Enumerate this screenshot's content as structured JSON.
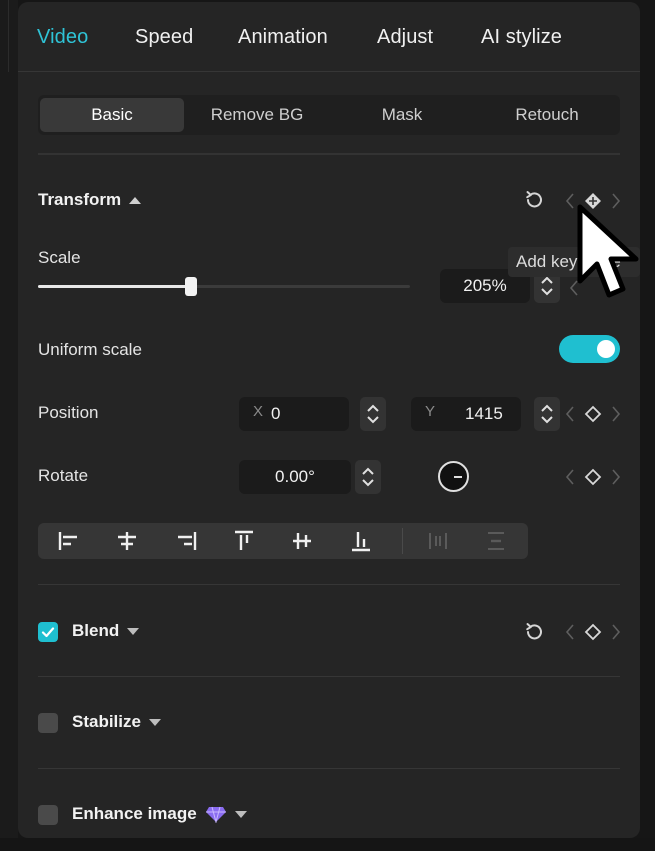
{
  "tabs": [
    "Video",
    "Speed",
    "Animation",
    "Adjust",
    "AI stylize"
  ],
  "segments": [
    "Basic",
    "Remove BG",
    "Mask",
    "Retouch"
  ],
  "transform": {
    "title": "Transform",
    "scale_label": "Scale",
    "scale_value": "205%",
    "scale_slider_fraction": 0.41,
    "uniform_scale_label": "Uniform scale",
    "uniform_scale_on": true,
    "position_label": "Position",
    "x_axis": "X",
    "x_value": "0",
    "y_axis": "Y",
    "y_value": "1415",
    "rotate_label": "Rotate",
    "rotate_value": "0.00°"
  },
  "tooltip": "Add keyframe",
  "blend": {
    "label": "Blend",
    "checked": true
  },
  "stabilize": {
    "label": "Stabilize",
    "checked": false
  },
  "enhance": {
    "label": "Enhance image",
    "checked": false
  },
  "colors": {
    "accent": "#1fbfd0",
    "active_tab": "#2fc3d6",
    "panel": "#252525"
  },
  "icons": [
    "reset-icon",
    "keyframe-diamond-icon",
    "chevron-left-icon",
    "chevron-right-icon",
    "align-left-icon",
    "align-center-h-icon",
    "align-right-icon",
    "align-top-icon",
    "align-middle-v-icon",
    "align-bottom-icon",
    "distribute-h-icon",
    "distribute-v-icon",
    "check-icon",
    "premium-gem-icon",
    "mouse-cursor-icon"
  ]
}
